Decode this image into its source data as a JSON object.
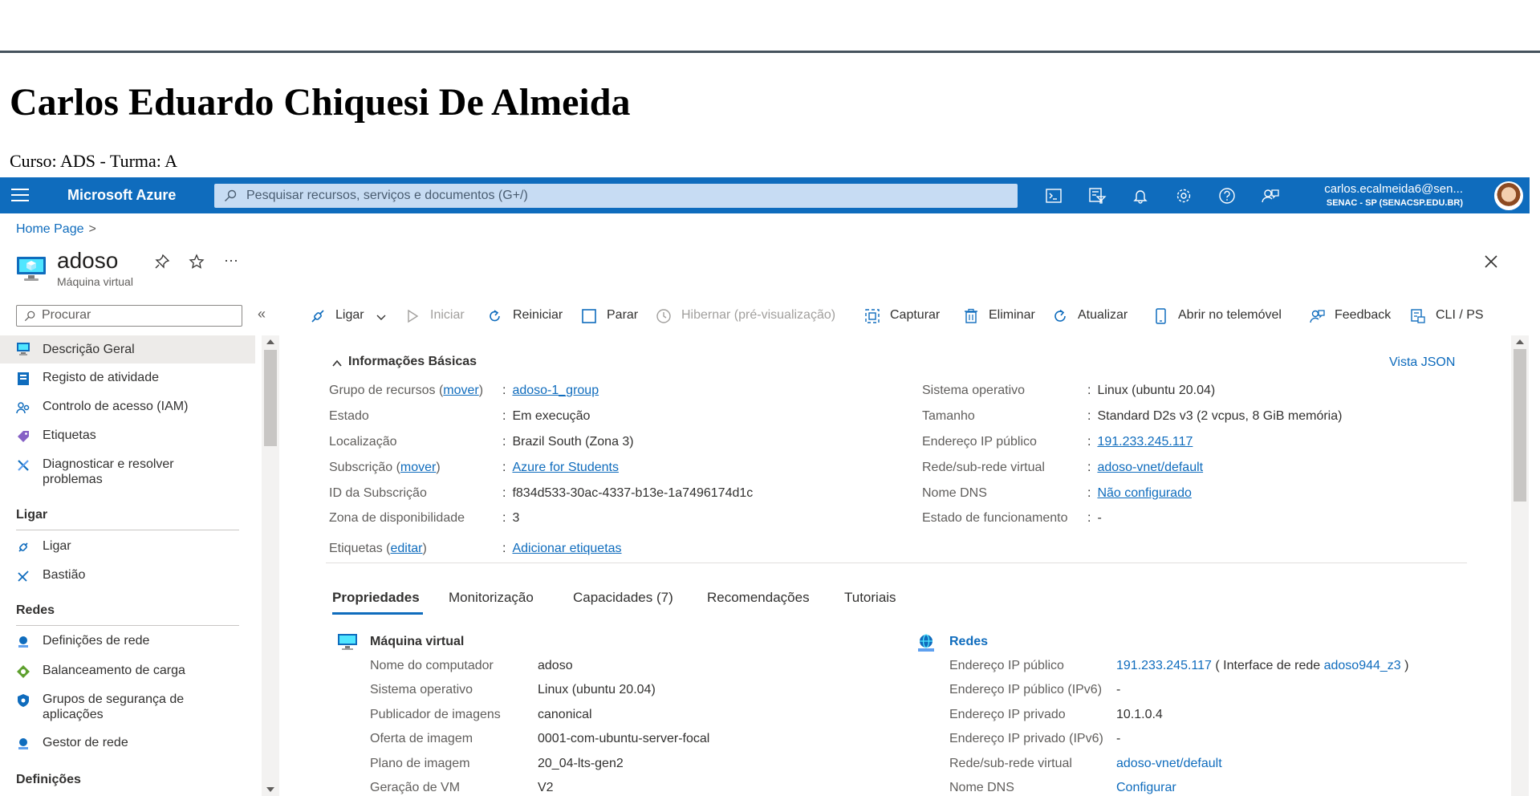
{
  "doc": {
    "title": "Carlos Eduardo Chiquesi De Almeida",
    "course": "Curso: ADS - Turma: A"
  },
  "topbar": {
    "brand": "Microsoft Azure",
    "search_placeholder": "Pesquisar recursos, serviços e documentos (G+/)",
    "icons": [
      "cloud-shell-icon",
      "directory-filter-icon",
      "notifications-icon",
      "settings-icon",
      "help-icon",
      "feedback-icon"
    ],
    "account_name": "carlos.ecalmeida6@sen...",
    "account_org": "SENAC - SP (SENACSP.EDU.BR)",
    "accent": "#0f6cbd"
  },
  "breadcrumb": {
    "home": "Home Page",
    "sep": ">"
  },
  "resource": {
    "name": "adoso",
    "type": "Máquina virtual",
    "more": "···"
  },
  "nav": {
    "search_placeholder": "Procurar",
    "collapse": "«",
    "items": [
      {
        "label": "Descrição Geral"
      },
      {
        "label": "Registo de atividade"
      },
      {
        "label": "Controlo de acesso (IAM)"
      },
      {
        "label": "Etiquetas"
      },
      {
        "label": "Diagnosticar e resolver"
      },
      {
        "label": "problemas"
      },
      {
        "label": "Ligar"
      },
      {
        "label": "Bastião"
      },
      {
        "label": "Definições de rede"
      },
      {
        "label": "Balanceamento de carga"
      },
      {
        "label": "Grupos de segurança de"
      },
      {
        "label": "aplicações"
      },
      {
        "label": "Gestor de rede"
      }
    ],
    "headers": [
      "Ligar",
      "Redes",
      "Definições"
    ]
  },
  "toolbar": {
    "connect": "Ligar",
    "start": "Iniciar",
    "restart": "Reiniciar",
    "stop": "Parar",
    "hibernate": "Hibernar (pré-visualização)",
    "capture": "Capturar",
    "delete": "Eliminar",
    "refresh": "Atualizar",
    "mobile": "Abrir no telemóvel",
    "feedback": "Feedback",
    "cli": "CLI / PS"
  },
  "essentials": {
    "title": "Informações Básicas",
    "json_view": "Vista JSON",
    "colon": ":",
    "left": [
      {
        "key": "Grupo de recursos (",
        "key_link": "mover",
        "key_end": ")",
        "value": "adoso-1_group",
        "link": true
      },
      {
        "key": "Estado",
        "value": "Em execução",
        "link": false
      },
      {
        "key": "Localização",
        "value": "Brazil South (Zona 3)",
        "link": false
      },
      {
        "key": "Subscrição (",
        "key_link": "mover",
        "key_end": ")",
        "value": "Azure for Students",
        "link": true
      },
      {
        "key": "ID da Subscrição",
        "value": "f834d533-30ac-4337-b13e-1a7496174d1c",
        "link": false
      },
      {
        "key": "Zona de disponibilidade",
        "value": "3",
        "link": false
      },
      {
        "key": "Etiquetas (",
        "key_link": "editar",
        "key_end": ")",
        "value": "Adicionar etiquetas",
        "link": true
      }
    ],
    "right": [
      {
        "key": "Sistema operativo",
        "value": "Linux (ubuntu 20.04)",
        "link": false
      },
      {
        "key": "Tamanho",
        "value": "Standard D2s v3 (2 vcpus, 8 GiB memória)",
        "link": false
      },
      {
        "key": "Endereço IP público",
        "value": "191.233.245.117",
        "link": true
      },
      {
        "key": "Rede/sub-rede virtual",
        "value": "adoso-vnet/default",
        "link": true
      },
      {
        "key": "Nome DNS",
        "value": "Não configurado",
        "link": true
      },
      {
        "key": "Estado de funcionamento",
        "value": "-",
        "link": false
      }
    ]
  },
  "tabs": [
    "Propriedades",
    "Monitorização",
    "Capacidades (7)",
    "Recomendações",
    "Tutoriais"
  ],
  "properties": {
    "vm": {
      "title": "Máquina virtual",
      "rows": [
        {
          "key": "Nome do computador",
          "value": "adoso"
        },
        {
          "key": "Sistema operativo",
          "value": "Linux (ubuntu 20.04)"
        },
        {
          "key": "Publicador de imagens",
          "value": "canonical"
        },
        {
          "key": "Oferta de imagem",
          "value": "0001-com-ubuntu-server-focal"
        },
        {
          "key": "Plano de imagem",
          "value": "20_04-lts-gen2"
        },
        {
          "key": "Geração de VM",
          "value": "V2"
        }
      ]
    },
    "net": {
      "title": "Redes",
      "ip_public_key": "Endereço IP público",
      "ip_public_value": "191.233.245.117",
      "ip_public_mid": "( Interface de rede",
      "ip_public_nic": "adoso944_z3",
      "ip_public_end": ")",
      "rows": [
        {
          "key": "Endereço IP público (IPv6)",
          "value": "-",
          "link": false
        },
        {
          "key": "Endereço IP privado",
          "value": "10.1.0.4",
          "link": false
        },
        {
          "key": "Endereço IP privado (IPv6)",
          "value": "-",
          "link": false
        },
        {
          "key": "Rede/sub-rede virtual",
          "value": "adoso-vnet/default",
          "link": true
        },
        {
          "key": "Nome DNS",
          "value": "Configurar",
          "link": true
        }
      ]
    }
  }
}
